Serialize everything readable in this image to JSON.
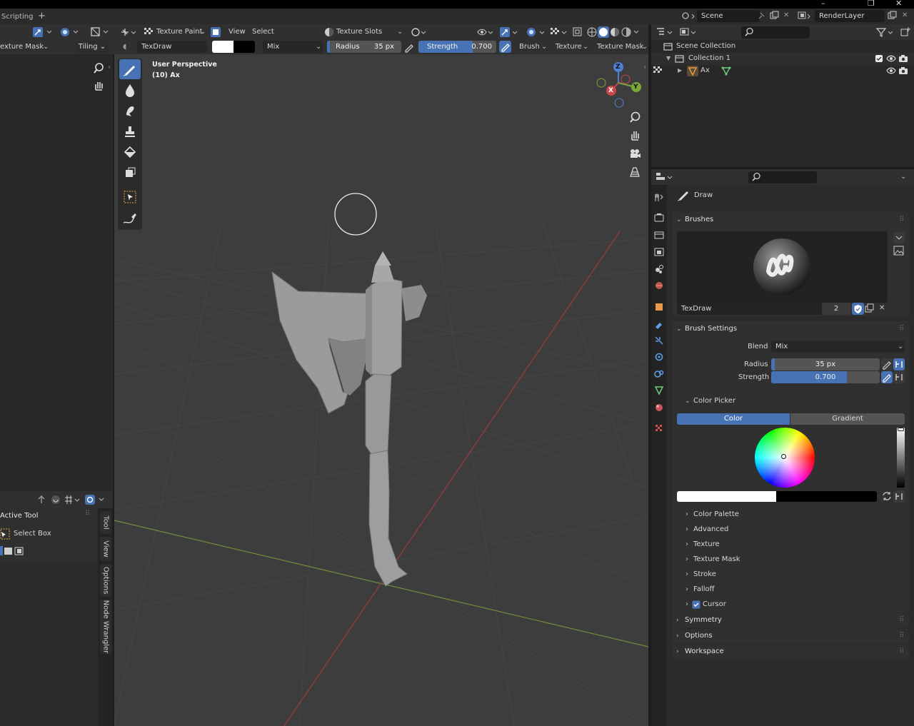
{
  "window": {
    "minimize": "–",
    "maximize": "❐",
    "close": "✕"
  },
  "workspace_tabs": {
    "active": "Scripting",
    "add": "+"
  },
  "scene": {
    "scene_name": "Scene",
    "render_layer": "RenderLayer"
  },
  "left_header": {
    "texture_mask": "exture Mask",
    "tiling": "Tiling"
  },
  "viewport_header": {
    "mode": "Texture Paint",
    "menu_view": "View",
    "menu_select": "Select",
    "texture_slots": "Texture Slots",
    "brush_name": "TexDraw",
    "blend": "Mix",
    "radius_label": "Radius",
    "radius_value": "35 px",
    "strength_label": "Strength",
    "strength_value": "0.700",
    "strength_fraction": 0.7,
    "menu_brush": "Brush",
    "menu_texture": "Texture",
    "menu_texture_mask": "Texture Mask"
  },
  "viewport": {
    "perspective": "User Perspective",
    "object_info": "(10) Ax"
  },
  "gizmo": {
    "z": "Z",
    "y": "Y",
    "x": "X"
  },
  "active_tool": {
    "title": "Active Tool",
    "tool_name": "Select Box"
  },
  "sidebar_tabs": [
    "Tool",
    "View",
    "Options",
    "Node Wrangler"
  ],
  "outliner": {
    "scene_collection": "Scene Collection",
    "collection": "Collection 1",
    "object": "Ax"
  },
  "properties": {
    "tool_name": "Draw",
    "brushes_panel": "Brushes",
    "brush_name": "TexDraw",
    "brush_users": "2",
    "brush_settings": "Brush Settings",
    "blend_label": "Blend",
    "blend_value": "Mix",
    "radius_label": "Radius",
    "radius_value": "35 px",
    "strength_label": "Strength",
    "strength_value": "0.700",
    "strength_fraction": 0.7,
    "color_picker": "Color Picker",
    "color_tab": "Color",
    "gradient_tab": "Gradient",
    "subpanels": [
      "Color Palette",
      "Advanced",
      "Texture",
      "Texture Mask",
      "Stroke",
      "Falloff"
    ],
    "cursor_label": "Cursor",
    "bottom_panels": [
      "Symmetry",
      "Options",
      "Workspace"
    ]
  },
  "colors": {
    "accent": "#4772b3",
    "viewport_bg": "#3d3d3d",
    "x_axis": "#c94747",
    "y_axis": "#7aa83a",
    "z_axis": "#4f80d6"
  }
}
